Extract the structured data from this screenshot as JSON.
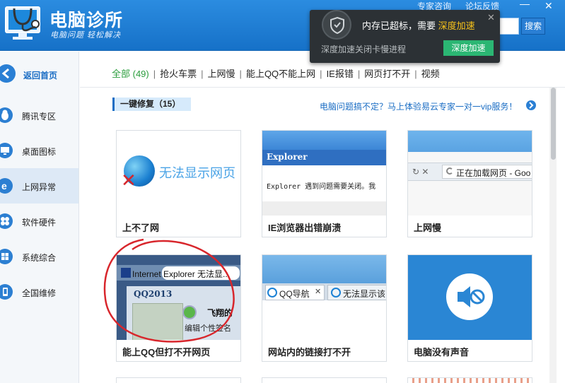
{
  "header": {
    "title": "电脑诊所",
    "subtitle": "电脑问题 轻松解决",
    "links": {
      "consult": "专家咨询",
      "feedback": "论坛反馈"
    },
    "minimize": "—",
    "close": "✕",
    "search_button": "搜索"
  },
  "popup": {
    "message_main": "内存已超标，需要",
    "message_accent": "深度加速",
    "sub_text": "深度加速关闭卡慢进程",
    "button": "深度加速",
    "close": "✕",
    "accent_color": "#f7c21a",
    "button_color": "#2bb673"
  },
  "sidebar": {
    "back_label": "返回首页",
    "items": [
      {
        "label": "腾讯专区",
        "icon": "penguin-icon"
      },
      {
        "label": "桌面图标",
        "icon": "monitor-icon"
      },
      {
        "label": "上网异常",
        "icon": "ie-icon",
        "active": true
      },
      {
        "label": "软件硬件",
        "icon": "puzzle-icon"
      },
      {
        "label": "系统综合",
        "icon": "windows-icon"
      },
      {
        "label": "全国维修",
        "icon": "phone-icon"
      }
    ]
  },
  "tabs": [
    {
      "label": "全部 (49)",
      "active": true
    },
    {
      "label": "抢火车票"
    },
    {
      "label": "上网慢"
    },
    {
      "label": "能上QQ不能上网"
    },
    {
      "label": "IE报错"
    },
    {
      "label": "网页打不开"
    },
    {
      "label": "视频"
    }
  ],
  "section": {
    "title": "一键修复（15）",
    "vip_link": "电脑问题搞不定？马上体验易云专家一对一vip服务！"
  },
  "cards": [
    {
      "label": "上不了网",
      "thumb_text": "无法显示网页"
    },
    {
      "label": "IE浏览器出错崩溃",
      "thumb_title": "Explorer",
      "thumb_msg": "Explorer 遇到问题需要关闭。我"
    },
    {
      "label": "上网慢",
      "thumb_text": "正在加载网页 - Goo",
      "thumb_nav": "↻ ✕"
    },
    {
      "label": "能上QQ但打不开网页",
      "thumb_bar": "Internet Explorer 无法显...",
      "thumb_qq": "QQ2013",
      "thumb_name": "飞翔的",
      "thumb_sig": "编辑个性签名"
    },
    {
      "label": "网站内的链接打不开",
      "thumb_tab1": "QQ导航",
      "thumb_tab2": "无法显示该"
    },
    {
      "label": "电脑没有声音"
    }
  ]
}
